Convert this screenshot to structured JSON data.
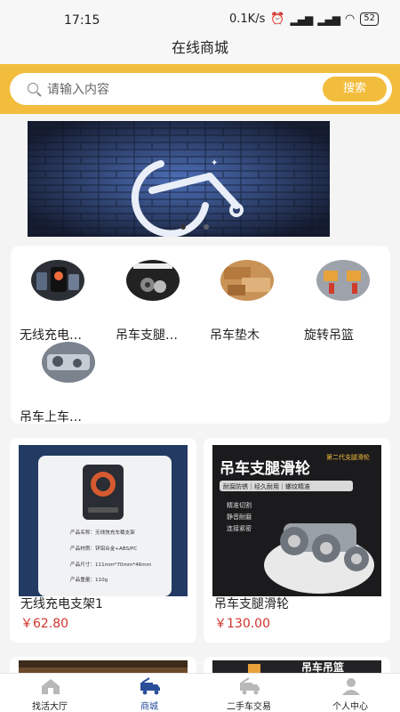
{
  "status": {
    "time": "17:15",
    "net": "0.1K/s",
    "battery": "52"
  },
  "header": {
    "title": "在线商城"
  },
  "search": {
    "placeholder": "请输入内容",
    "button": "搜索"
  },
  "banner": {
    "active_index": 0,
    "count": 2
  },
  "categories": [
    {
      "label": "无线充电…",
      "icon": "wireless-charger-thumb"
    },
    {
      "label": "吊车支腿…",
      "icon": "outrigger-pulley-thumb"
    },
    {
      "label": "吊车垫木",
      "icon": "crane-pad-thumb"
    },
    {
      "label": "旋转吊篮",
      "icon": "rotating-basket-thumb"
    },
    {
      "label": "吊车上车…",
      "icon": "crane-upper-thumb"
    }
  ],
  "products": [
    {
      "name": "无线充电支架1",
      "price": "￥62.80",
      "image_text": {
        "l1": "产品名称：无线快充车载支架",
        "l2": "产品材质：锌铝合金+ABS/PC",
        "l3": "产品尺寸：111mm*70mm*46mm",
        "l4": "产品重量：110g"
      }
    },
    {
      "name": "吊车支腿滑轮",
      "price": "￥130.00",
      "image_text": {
        "title": "吊车支腿滑轮",
        "tag": "第二代支腿滑轮",
        "bar": "耐腐防锈｜经久耐用｜螺纹精准",
        "f1": "精准切割",
        "f2": "静音耐磨",
        "f3": "连接紧密"
      }
    }
  ],
  "products_partial": [
    {
      "image_text": ""
    },
    {
      "image_text": "吊车吊篮"
    }
  ],
  "tabbar": [
    {
      "label": "找活大厅",
      "icon": "home-icon",
      "active": false
    },
    {
      "label": "商城",
      "icon": "truck-icon",
      "active": true
    },
    {
      "label": "二手车交易",
      "icon": "used-truck-icon",
      "active": false
    },
    {
      "label": "个人中心",
      "icon": "user-icon",
      "active": false
    }
  ],
  "colors": {
    "accent": "#f2bd3c",
    "price": "#d0342c",
    "active_tab": "#2a4e9a"
  }
}
